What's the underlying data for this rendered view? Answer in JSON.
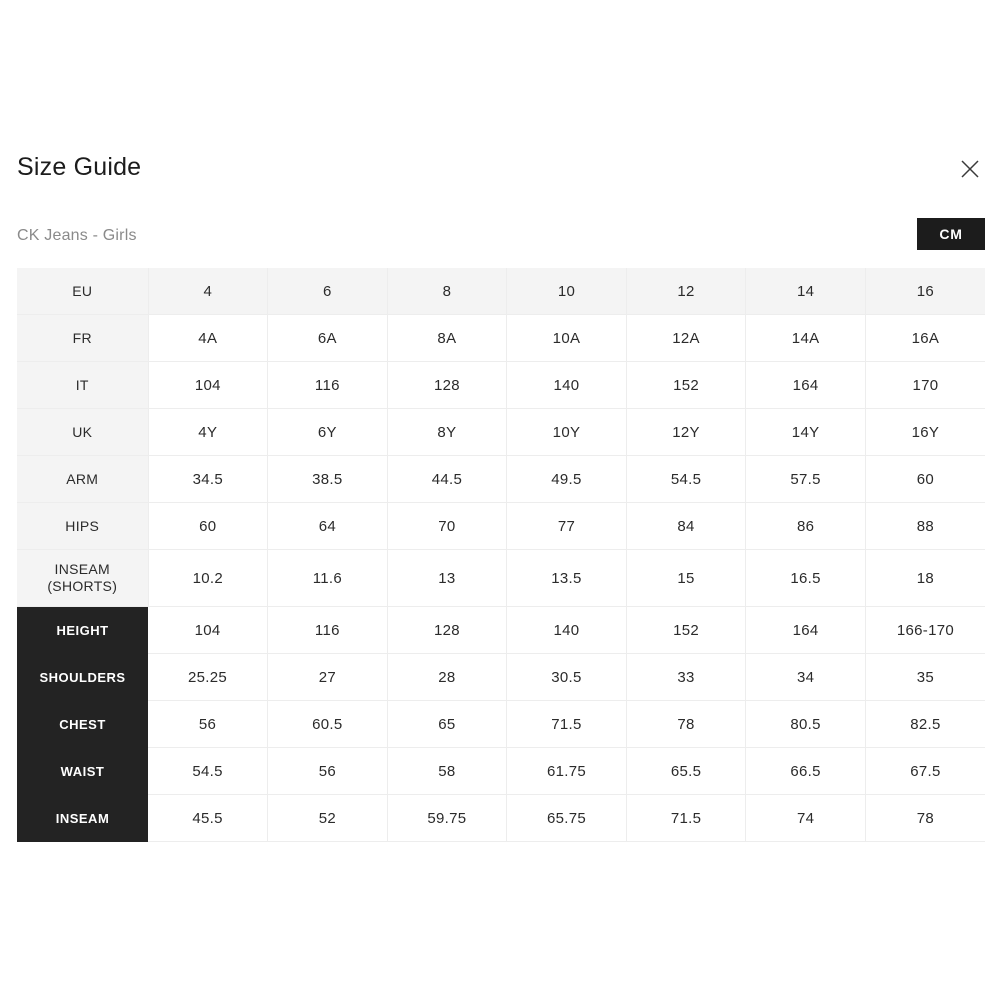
{
  "modal": {
    "title": "Size Guide",
    "subtitle": "CK Jeans - Girls",
    "close_icon": "close-icon"
  },
  "unit_toggle": {
    "selected": "CM",
    "options": [
      "CM"
    ]
  },
  "colors": {
    "page_background": "#ffffff",
    "text_primary": "#1c1c1c",
    "text_secondary": "#8a8a8a",
    "label_cell_light": "#f4f4f4",
    "label_cell_dark": "#232323",
    "grid_line": "#ededed",
    "accent": "#1c1c1c"
  },
  "table": {
    "columns": [
      "EU",
      "4",
      "6",
      "8",
      "10",
      "12",
      "14",
      "16"
    ],
    "rows": [
      {
        "label": "EU",
        "label_lines": [
          "EU"
        ],
        "style": "header",
        "values": [
          "4",
          "6",
          "8",
          "10",
          "12",
          "14",
          "16"
        ]
      },
      {
        "label": "FR",
        "label_lines": [
          "FR"
        ],
        "style": "size",
        "values": [
          "4A",
          "6A",
          "8A",
          "10A",
          "12A",
          "14A",
          "16A"
        ]
      },
      {
        "label": "IT",
        "label_lines": [
          "IT"
        ],
        "style": "size",
        "values": [
          "104",
          "116",
          "128",
          "140",
          "152",
          "164",
          "170"
        ]
      },
      {
        "label": "UK",
        "label_lines": [
          "UK"
        ],
        "style": "size",
        "values": [
          "4Y",
          "6Y",
          "8Y",
          "10Y",
          "12Y",
          "14Y",
          "16Y"
        ]
      },
      {
        "label": "ARM",
        "label_lines": [
          "ARM"
        ],
        "style": "size",
        "values": [
          "34.5",
          "38.5",
          "44.5",
          "49.5",
          "54.5",
          "57.5",
          "60"
        ]
      },
      {
        "label": "HIPS",
        "label_lines": [
          "HIPS"
        ],
        "style": "size",
        "values": [
          "60",
          "64",
          "70",
          "77",
          "84",
          "86",
          "88"
        ]
      },
      {
        "label": "INSEAM (SHORTS)",
        "label_lines": [
          "INSEAM",
          "(SHORTS)"
        ],
        "style": "size-tall",
        "values": [
          "10.2",
          "11.6",
          "13",
          "13.5",
          "15",
          "16.5",
          "18"
        ]
      },
      {
        "label": "HEIGHT",
        "label_lines": [
          "HEIGHT"
        ],
        "style": "measure",
        "values": [
          "104",
          "116",
          "128",
          "140",
          "152",
          "164",
          "166-170"
        ]
      },
      {
        "label": "SHOULDERS",
        "label_lines": [
          "SHOULDERS"
        ],
        "style": "measure",
        "values": [
          "25.25",
          "27",
          "28",
          "30.5",
          "33",
          "34",
          "35"
        ]
      },
      {
        "label": "CHEST",
        "label_lines": [
          "CHEST"
        ],
        "style": "measure",
        "values": [
          "56",
          "60.5",
          "65",
          "71.5",
          "78",
          "80.5",
          "82.5"
        ]
      },
      {
        "label": "WAIST",
        "label_lines": [
          "WAIST"
        ],
        "style": "measure",
        "values": [
          "54.5",
          "56",
          "58",
          "61.75",
          "65.5",
          "66.5",
          "67.5"
        ]
      },
      {
        "label": "INSEAM",
        "label_lines": [
          "INSEAM"
        ],
        "style": "measure",
        "values": [
          "45.5",
          "52",
          "59.75",
          "65.75",
          "71.5",
          "74",
          "78"
        ]
      }
    ]
  }
}
